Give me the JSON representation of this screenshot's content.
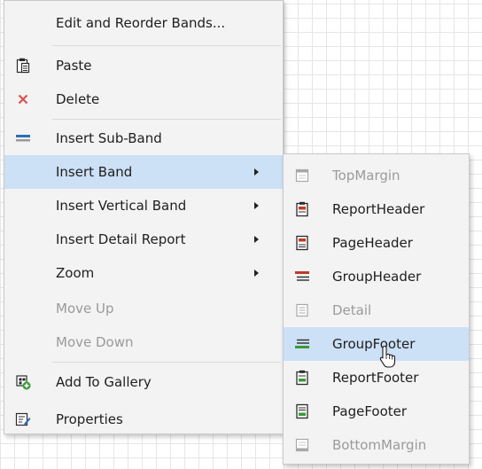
{
  "main_menu": {
    "items": [
      {
        "label": "Edit and Reorder Bands...",
        "icon": "",
        "has_submenu": false,
        "enabled": true
      },
      {
        "label": "Paste",
        "icon": "clipboard-icon",
        "has_submenu": false,
        "enabled": true
      },
      {
        "label": "Delete",
        "icon": "delete-x-icon",
        "has_submenu": false,
        "enabled": true
      },
      {
        "label": "Insert Sub-Band",
        "icon": "sub-band-icon",
        "has_submenu": false,
        "enabled": true
      },
      {
        "label": "Insert Band",
        "icon": "",
        "has_submenu": true,
        "enabled": true,
        "highlighted": true
      },
      {
        "label": "Insert Vertical Band",
        "icon": "",
        "has_submenu": true,
        "enabled": true
      },
      {
        "label": "Insert Detail Report",
        "icon": "",
        "has_submenu": true,
        "enabled": true
      },
      {
        "label": "Zoom",
        "icon": "",
        "has_submenu": true,
        "enabled": true
      },
      {
        "label": "Move Up",
        "icon": "",
        "has_submenu": false,
        "enabled": false
      },
      {
        "label": "Move Down",
        "icon": "",
        "has_submenu": false,
        "enabled": false
      },
      {
        "label": "Add To Gallery",
        "icon": "add-to-gallery-icon",
        "has_submenu": false,
        "enabled": true
      },
      {
        "label": "Properties",
        "icon": "properties-icon",
        "has_submenu": false,
        "enabled": true
      }
    ]
  },
  "band_submenu": {
    "items": [
      {
        "label": "TopMargin",
        "icon": "top-margin-band-icon",
        "enabled": false
      },
      {
        "label": "ReportHeader",
        "icon": "report-header-band-icon",
        "enabled": true
      },
      {
        "label": "PageHeader",
        "icon": "page-header-band-icon",
        "enabled": true
      },
      {
        "label": "GroupHeader",
        "icon": "group-header-band-icon",
        "enabled": true
      },
      {
        "label": "Detail",
        "icon": "detail-band-icon",
        "enabled": false
      },
      {
        "label": "GroupFooter",
        "icon": "group-footer-band-icon",
        "enabled": true,
        "highlighted": true
      },
      {
        "label": "ReportFooter",
        "icon": "report-footer-band-icon",
        "enabled": true
      },
      {
        "label": "PageFooter",
        "icon": "page-footer-band-icon",
        "enabled": true
      },
      {
        "label": "BottomMargin",
        "icon": "bottom-margin-band-icon",
        "enabled": false
      }
    ]
  },
  "colors": {
    "menu_bg": "#f3f3f3",
    "highlight": "#cce0f6",
    "disabled_text": "#9a9a9a",
    "delete_red": "#d9534f",
    "band_red": "#c0392b",
    "band_green": "#3a9a3a",
    "accent_blue": "#2a6fb8"
  }
}
